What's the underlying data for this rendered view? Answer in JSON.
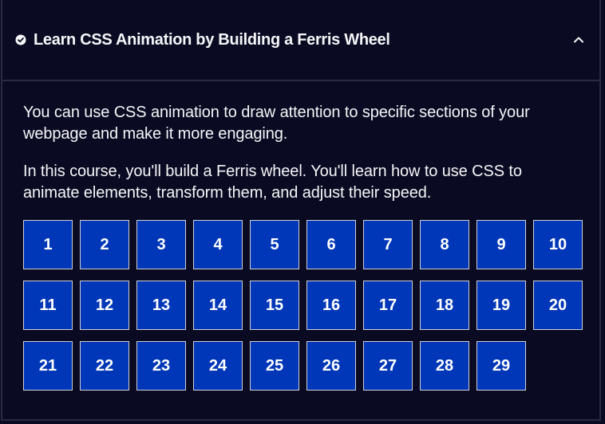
{
  "header": {
    "title": "Learn CSS Animation by Building a Ferris Wheel",
    "completed_icon": "check-circle-icon",
    "toggle_icon": "chevron-up-icon"
  },
  "description": {
    "paragraph1": "You can use CSS animation to draw attention to specific sections of your webpage and make it more engaging.",
    "paragraph2": "In this course, you'll build a Ferris wheel. You'll learn how to use CSS to animate elements, transform them, and adjust their speed."
  },
  "steps": [
    "1",
    "2",
    "3",
    "4",
    "5",
    "6",
    "7",
    "8",
    "9",
    "10",
    "11",
    "12",
    "13",
    "14",
    "15",
    "16",
    "17",
    "18",
    "19",
    "20",
    "21",
    "22",
    "23",
    "24",
    "25",
    "26",
    "27",
    "28",
    "29"
  ],
  "colors": {
    "background": "#0a0a23",
    "step_fill": "#0037b8",
    "step_border": "#d0d0d5",
    "text": "#f5f6f7"
  }
}
